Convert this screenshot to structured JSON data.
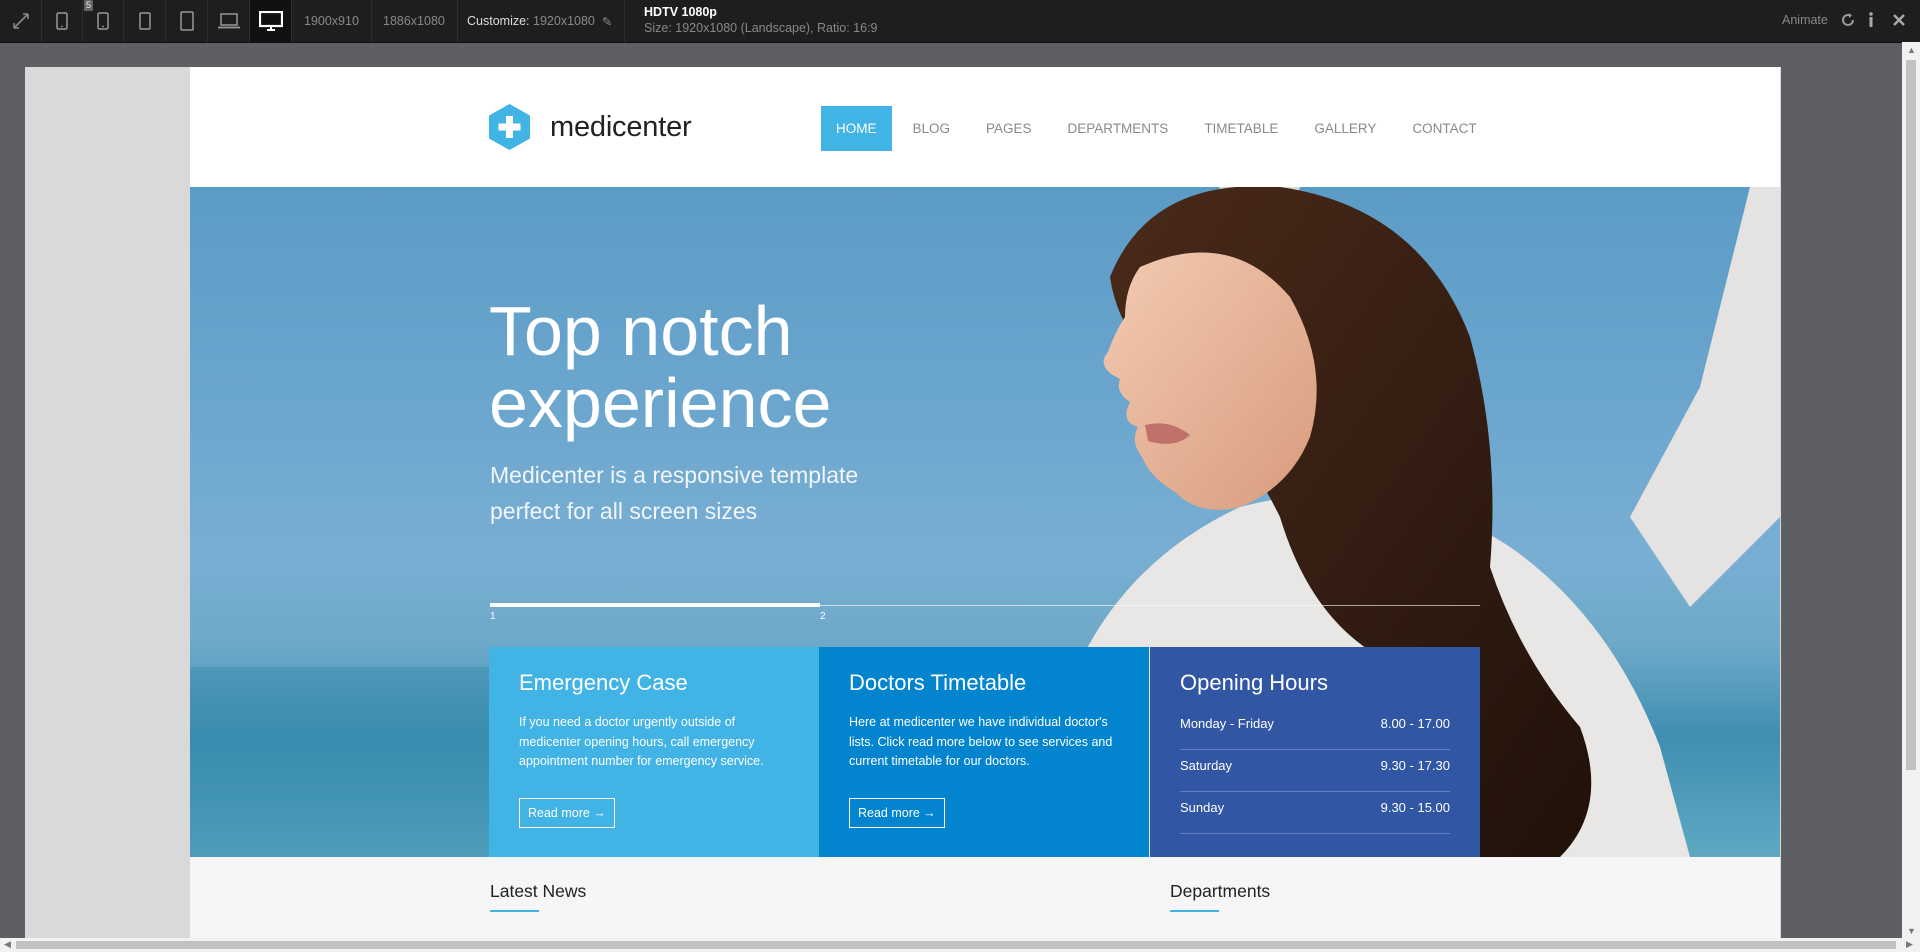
{
  "toolbar": {
    "preset1": "1900x910",
    "preset2": "1886x1080",
    "customize_label": "Customize:",
    "customize_value": "1920x1080",
    "badge": "5",
    "device_title": "HDTV 1080p",
    "device_sub": "Size: 1920x1080 (Landscape), Ratio: 16:9",
    "animate": "Animate"
  },
  "site": {
    "logo_name": "medicenter",
    "nav": [
      "HOME",
      "BLOG",
      "PAGES",
      "DEPARTMENTS",
      "TIMETABLE",
      "GALLERY",
      "CONTACT"
    ],
    "hero": {
      "title": "Top notch experience",
      "subtitle": "Medicenter is a responsive template perfect for all screen sizes",
      "slide1": "1",
      "slide2": "2",
      "progress": 0.333
    },
    "boxes": {
      "emergency": {
        "title": "Emergency Case",
        "text": "If you need a doctor urgently outside of medicenter opening hours, call emergency appointment number for emergency service.",
        "button": "Read more →"
      },
      "timetable": {
        "title": "Doctors Timetable",
        "text": "Here at medicenter we have individual doctor's lists. Click read more below to see services and current timetable for our doctors.",
        "button": "Read more →"
      },
      "hours": {
        "title": "Opening Hours",
        "rows": [
          {
            "day": "Monday - Friday",
            "time": "8.00 - 17.00"
          },
          {
            "day": "Saturday",
            "time": "9.30 - 17.30"
          },
          {
            "day": "Sunday",
            "time": "9.30 - 15.00"
          }
        ]
      }
    },
    "lower": {
      "news_title": "Latest News",
      "departments_title": "Departments"
    }
  },
  "colors": {
    "accent": "#42b3e5",
    "box2": "#0384ce",
    "box3": "#3156a3"
  }
}
